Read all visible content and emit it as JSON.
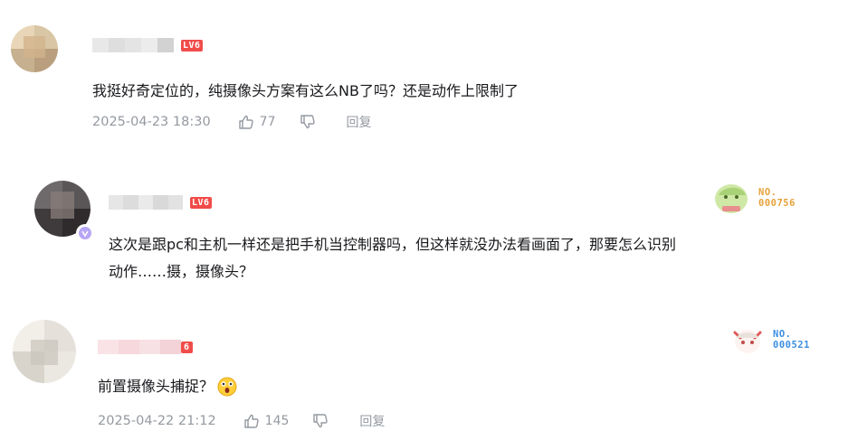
{
  "comments": [
    {
      "level": "LV6",
      "text": "我挺好奇定位的，纯摄像头方案有这么NB了吗？还是动作上限制了",
      "date": "2025-04-23 18:30",
      "likes": "77",
      "reply_label": "回复"
    },
    {
      "level": "LV6",
      "text_line1": "这次是跟pc和主机一样还是把手机当控制器吗，但这样就没办法看画面了，那要怎么识别",
      "text_line2": "动作……摄，摄像头？",
      "fan_badge_line1": "NO.",
      "fan_badge_line2": "000756",
      "fan_badge_color": "#e6a23c"
    },
    {
      "level": "6",
      "text": "前置摄像头捕捉？",
      "date": "2025-04-22 21:12",
      "likes": "145",
      "reply_label": "回复",
      "fan_badge_line1": "NO.",
      "fan_badge_line2": "000521",
      "fan_badge_color": "#3d8fe0"
    }
  ]
}
